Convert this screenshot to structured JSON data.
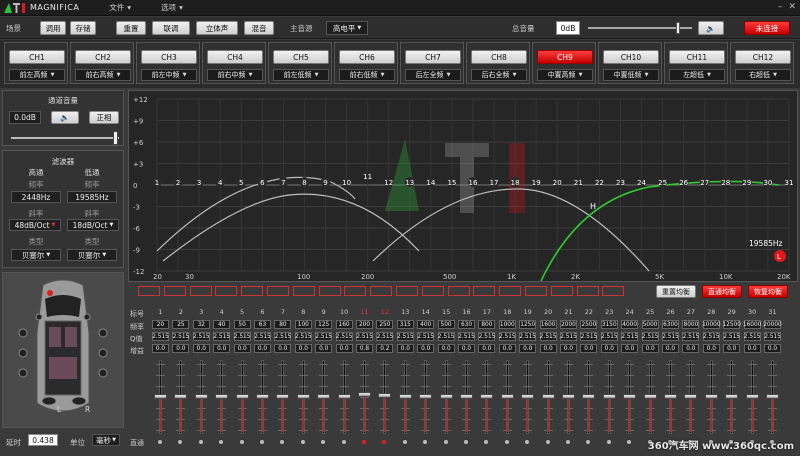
{
  "app": {
    "title": "MAGNIFICA",
    "menu": [
      {
        "label": "文件"
      },
      {
        "label": "选项"
      }
    ]
  },
  "toolbar": {
    "scene_label": "场景",
    "call_button": "调用",
    "save_button": "存储",
    "reset_button": "重置",
    "link_button": "联调",
    "stereo_button": "立体声",
    "mix_button": "混音",
    "source_label": "主音源",
    "source_value": "高电平",
    "master_label": "总音量",
    "master_value": "0dB",
    "connect_button": "未连接"
  },
  "channels": [
    {
      "name": "CH1",
      "assign": "前左高频",
      "active": false
    },
    {
      "name": "CH2",
      "assign": "前右高频",
      "active": false
    },
    {
      "name": "CH3",
      "assign": "前左中频",
      "active": false
    },
    {
      "name": "CH4",
      "assign": "前右中频",
      "active": false
    },
    {
      "name": "CH5",
      "assign": "前左低频",
      "active": false
    },
    {
      "name": "CH6",
      "assign": "前右低频",
      "active": false
    },
    {
      "name": "CH7",
      "assign": "后左全频",
      "active": false
    },
    {
      "name": "CH8",
      "assign": "后右全频",
      "active": false
    },
    {
      "name": "CH9",
      "assign": "中置高频",
      "active": true
    },
    {
      "name": "CH10",
      "assign": "中置低频",
      "active": false
    },
    {
      "name": "CH11",
      "assign": "左超低",
      "active": false
    },
    {
      "name": "CH12",
      "assign": "右超低",
      "active": false
    }
  ],
  "volume": {
    "title": "通道音量",
    "value": "0.0dB",
    "phase_button": "正相"
  },
  "filter": {
    "title": "滤波器",
    "hp_label": "高通",
    "lp_label": "低通",
    "freq_label": "频率",
    "hp_freq": "2448Hz",
    "lp_freq": "19585Hz",
    "slope_label": "斜率",
    "hp_slope": "48dB/Oct",
    "lp_slope": "18dB/Oct",
    "type_label": "类型",
    "hp_type": "贝塞尔",
    "lp_type": "贝塞尔"
  },
  "delay": {
    "label": "延时",
    "value": "0.438",
    "unit_label": "单位",
    "unit_value": "毫秒"
  },
  "car_labels": {
    "left": "L",
    "right": "R"
  },
  "graph": {
    "y_ticks": [
      "+12",
      "+9",
      "+6",
      "+3",
      "0",
      "-3",
      "-6",
      "-9",
      "-12"
    ],
    "x_ticks": [
      "20",
      "30",
      "100",
      "200",
      "500",
      "1K",
      "2K",
      "5K",
      "10K",
      "20K"
    ],
    "cursor_label": "19585Hz",
    "cursor_badge": "L",
    "marker_label": "H"
  },
  "eq_buttons": {
    "reset": "重置均衡",
    "bypass": "直通均衡",
    "restore": "恢复均衡"
  },
  "preset_chips": [
    "",
    "",
    "",
    "",
    "",
    "",
    "",
    "",
    "",
    "",
    "",
    "",
    "",
    "",
    "",
    "",
    "",
    "",
    ""
  ],
  "table": {
    "band_label": "标号",
    "freq_label": "频率",
    "q_label": "Q值",
    "gain_label": "增益",
    "bypass_label": "直通",
    "bands": [
      "1",
      "2",
      "3",
      "4",
      "5",
      "6",
      "7",
      "8",
      "9",
      "10",
      "11",
      "12",
      "13",
      "14",
      "15",
      "16",
      "17",
      "18",
      "19",
      "20",
      "21",
      "22",
      "23",
      "24",
      "25",
      "26",
      "27",
      "28",
      "29",
      "30",
      "31"
    ],
    "freqs": [
      "20",
      "25",
      "32",
      "40",
      "50",
      "63",
      "80",
      "100",
      "125",
      "160",
      "200",
      "250",
      "315",
      "400",
      "500",
      "630",
      "800",
      "1000",
      "1250",
      "1600",
      "2000",
      "2500",
      "3150",
      "4000",
      "5000",
      "6300",
      "8000",
      "10000",
      "12500",
      "16000",
      "20000"
    ],
    "qs": [
      "2.515",
      "2.515",
      "2.515",
      "2.515",
      "2.515",
      "2.515",
      "2.515",
      "2.515",
      "2.515",
      "2.515",
      "2.515",
      "2.515",
      "2.515",
      "2.515",
      "2.515",
      "2.515",
      "2.515",
      "2.515",
      "2.515",
      "2.515",
      "2.515",
      "2.515",
      "2.515",
      "2.515",
      "2.515",
      "2.515",
      "2.515",
      "2.515",
      "2.515",
      "2.515",
      "2.515"
    ],
    "gains": [
      "0.0",
      "0.0",
      "0.0",
      "0.0",
      "0.0",
      "0.0",
      "0.0",
      "0.0",
      "0.0",
      "0.0",
      "0.8",
      "0.2",
      "0.0",
      "0.0",
      "0.0",
      "0.0",
      "0.0",
      "0.0",
      "0.0",
      "0.0",
      "0.0",
      "0.0",
      "0.0",
      "0.0",
      "0.0",
      "0.0",
      "0.0",
      "0.0",
      "0.0",
      "0.0",
      "0.0"
    ],
    "highlight_bands": [
      11,
      12
    ]
  },
  "watermark": "360汽车网 www.360qc.com"
}
